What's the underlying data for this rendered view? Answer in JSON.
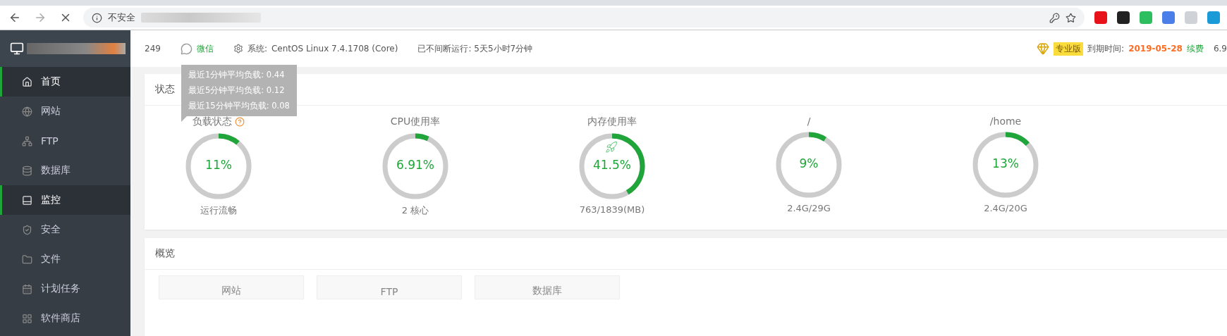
{
  "browser": {
    "security_label": "不安全"
  },
  "header": {
    "host_suffix": "249",
    "wechat": "微信",
    "system_label": "系统:",
    "system_value": "CentOS Linux 7.4.1708 (Core)",
    "uptime": "已不间断运行: 5天5小时7分钟",
    "edition": "专业版",
    "expiry_label": "到期时间:",
    "expiry_date": "2019-05-28",
    "renew": "续费",
    "version": "6.9"
  },
  "sidebar": {
    "items": [
      {
        "label": "首页",
        "selected": true
      },
      {
        "label": "网站",
        "selected": false
      },
      {
        "label": "FTP",
        "selected": false
      },
      {
        "label": "数据库",
        "selected": false
      },
      {
        "label": "监控",
        "selected": true
      },
      {
        "label": "安全",
        "selected": false
      },
      {
        "label": "文件",
        "selected": false
      },
      {
        "label": "计划任务",
        "selected": false
      },
      {
        "label": "软件商店",
        "selected": false
      }
    ]
  },
  "status": {
    "title": "状态",
    "gauges": [
      {
        "kind": "load",
        "title": "负载状态",
        "value": "11%",
        "level": 0.11,
        "caption": "运行流畅"
      },
      {
        "kind": "cpu",
        "title": "CPU使用率",
        "value": "6.91%",
        "level": 0.0691,
        "caption": "2 核心"
      },
      {
        "kind": "memory",
        "title": "内存使用率",
        "value": "41.5%",
        "level": 0.415,
        "caption": "763/1839(MB)"
      },
      {
        "kind": "disk",
        "title": "/",
        "value": "9%",
        "level": 0.09,
        "caption": "2.4G/29G"
      },
      {
        "kind": "disk",
        "title": "/home",
        "value": "13%",
        "level": 0.13,
        "caption": "2.4G/20G"
      }
    ],
    "tooltip": [
      "最近1分钟平均负载: 0.44",
      "最近5分钟平均负载: 0.12",
      "最近15分钟平均负载: 0.08"
    ]
  },
  "overview": {
    "title": "概览",
    "cards": [
      "网站",
      "FTP",
      "数据库"
    ]
  }
}
